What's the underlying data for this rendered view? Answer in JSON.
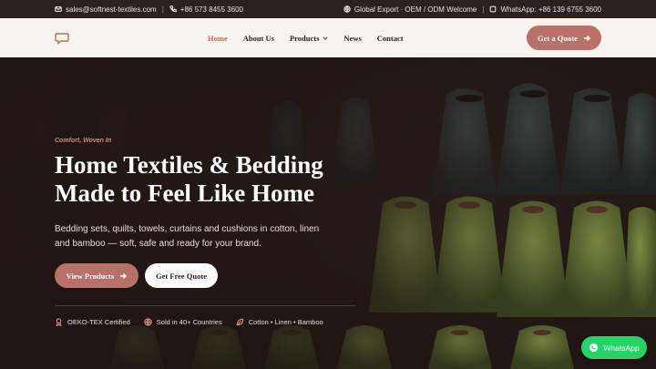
{
  "topbar": {
    "email": "sales@softnest-textiles.com",
    "phone": "+86 573 8455 3600",
    "export_text": "Global Export · OEM / ODM Welcome",
    "whatsapp_text": "WhatsApp: +86 139 6755 3600"
  },
  "header": {
    "nav": [
      {
        "label": "Home",
        "active": true
      },
      {
        "label": "About Us"
      },
      {
        "label": "Products",
        "dropdown": true
      },
      {
        "label": "News"
      },
      {
        "label": "Contact"
      }
    ],
    "cta_label": "Get a Quote",
    "logo_icon": "chat-bubble-icon"
  },
  "hero": {
    "tagline": "Comfort, Woven In",
    "title_line1": "Home Textiles & Bedding",
    "title_line2": "Made to Feel Like Home",
    "subtitle": "Bedding sets, quilts, towels, curtains and cushions in cotton, linen and bamboo — soft, safe and ready for your brand.",
    "primary_button": "View Products",
    "secondary_button": "Get Free Quote",
    "badges": [
      {
        "icon": "ribbon-icon",
        "label": "OEKO-TEX Certified"
      },
      {
        "icon": "globe-icon",
        "label": "Sold in 40+ Countries"
      },
      {
        "icon": "leaf-icon",
        "label": "Cotton • Linen • Bamboo"
      }
    ]
  },
  "whatsapp_button": "WhatsApp",
  "colors": {
    "accent": "#b87169",
    "header_bg": "#f8f3ee",
    "topbar_bg": "#2b2220",
    "whatsapp": "#25d366"
  }
}
